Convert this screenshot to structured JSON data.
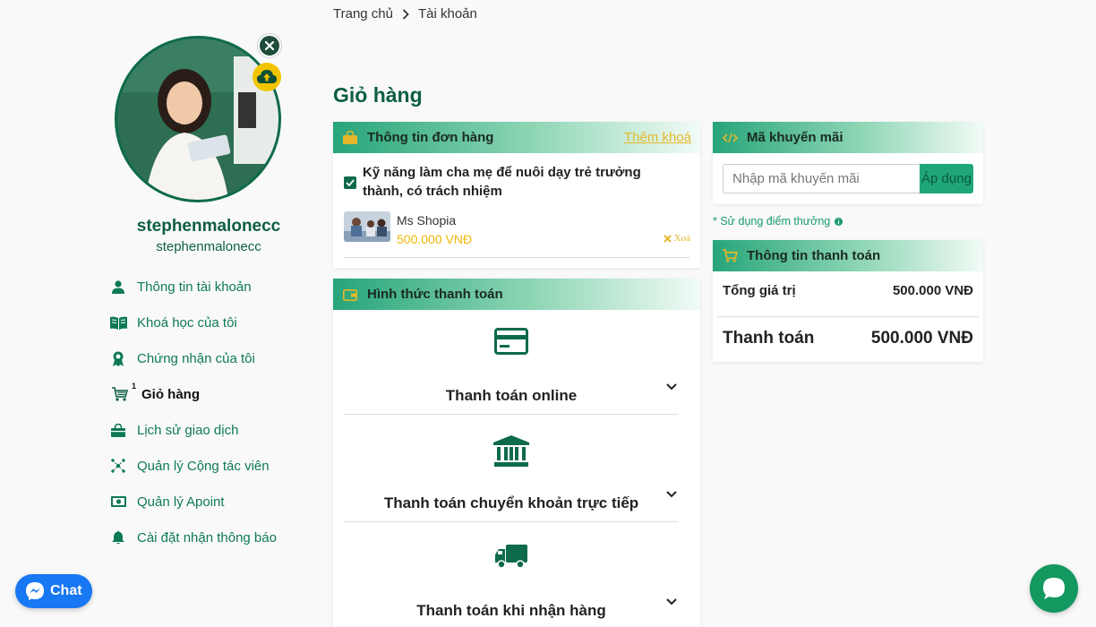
{
  "breadcrumb": {
    "home": "Trang chủ",
    "current": "Tài khoản"
  },
  "profile": {
    "name": "stephenmalonecc",
    "username": "stephenmalonecc"
  },
  "sidebar": {
    "items": [
      {
        "label": "Thông tin tài khoản",
        "icon": "user-icon"
      },
      {
        "label": "Khoá học của tôi",
        "icon": "book-icon"
      },
      {
        "label": "Chứng nhận của tôi",
        "icon": "award-icon"
      },
      {
        "label": "Giỏ hàng",
        "icon": "cart-icon",
        "badge": "1",
        "active": true
      },
      {
        "label": "Lịch sử giao dịch",
        "icon": "bag-icon"
      },
      {
        "label": "Quản lý Cộng tác viên",
        "icon": "network-icon"
      },
      {
        "label": "Quản lý Apoint",
        "icon": "money-icon"
      },
      {
        "label": "Cài đặt nhận thông báo",
        "icon": "bell-icon"
      }
    ]
  },
  "page": {
    "title": "Giỏ hàng"
  },
  "order": {
    "header": "Thông tin đơn hàng",
    "add_link": "Thêm khoá",
    "item": {
      "title": "Kỹ năng làm cha mẹ để nuôi dạy trẻ trưởng thành, có trách nhiệm",
      "teacher": "Ms Shopia",
      "price": "500.000 VNĐ",
      "remove_label": "Xoá",
      "checked": true
    }
  },
  "payment": {
    "header": "Hình thức thanh toán",
    "options": [
      {
        "label": "Thanh toán online",
        "icon": "credit-card-icon"
      },
      {
        "label": "Thanh toán chuyển khoản trực tiếp",
        "icon": "bank-icon"
      },
      {
        "label": "Thanh toán khi nhận hàng",
        "icon": "truck-icon"
      }
    ]
  },
  "promo": {
    "header": "Mã khuyến mãi",
    "placeholder": "Nhập mã khuyến mãi",
    "apply_label": "Áp dụng",
    "points_note": "* Sử dụng điểm thưởng"
  },
  "summary": {
    "header": "Thông tin thanh toán",
    "total_label": "Tổng giá trị",
    "total_value": "500.000 VNĐ",
    "pay_label": "Thanh toán",
    "pay_value": "500.000 VNĐ"
  },
  "chat": {
    "label": "Chat"
  },
  "colors": {
    "brand_green": "#0e7a55",
    "accent_yellow": "#f2b705",
    "messenger_blue": "#1877f2"
  }
}
